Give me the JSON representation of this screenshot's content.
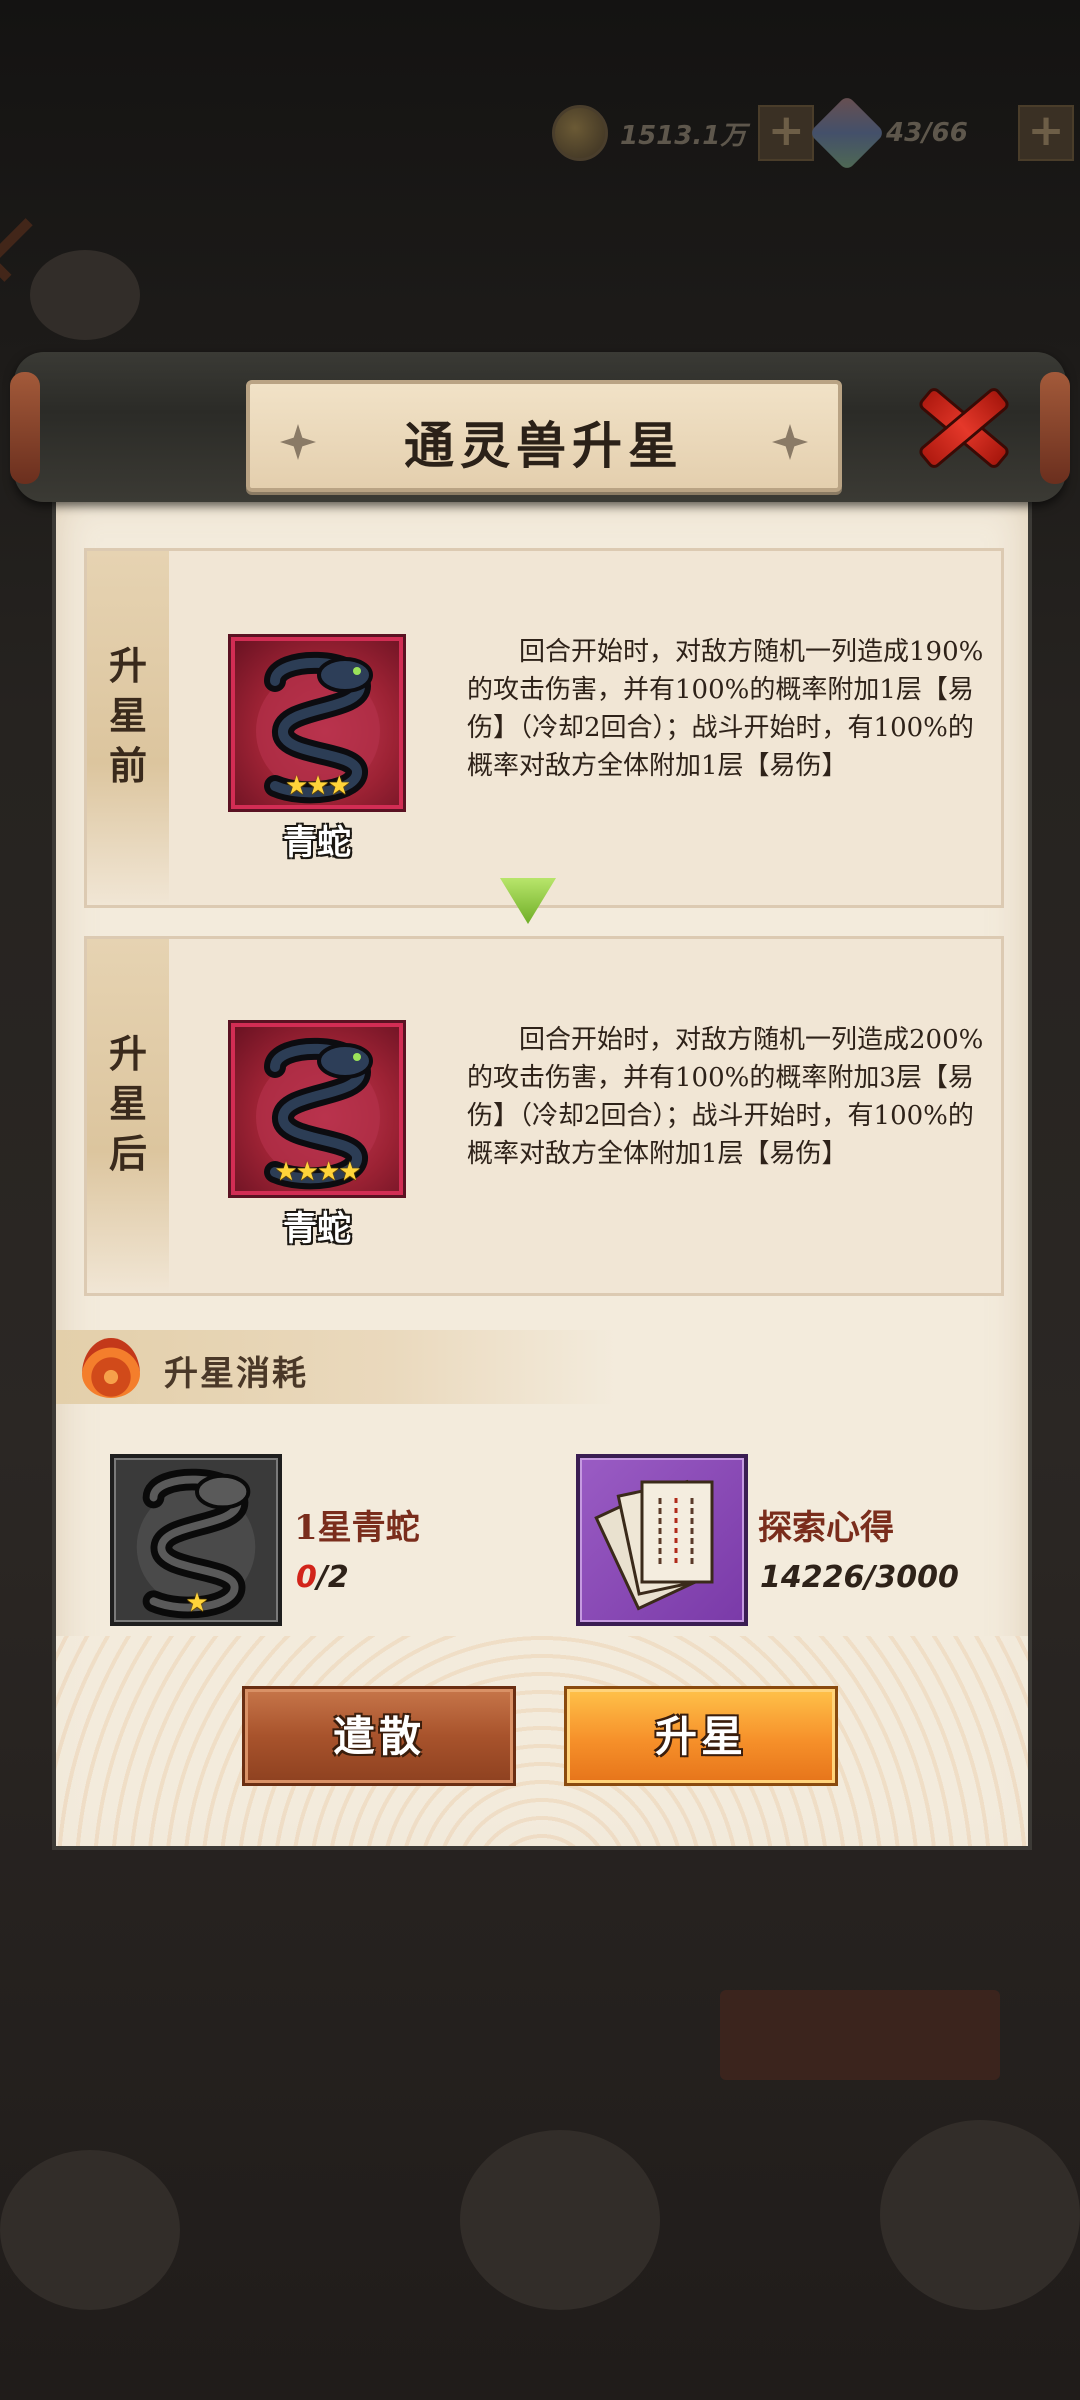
{
  "background": {
    "gold_amount": "1513.1万",
    "gem_amount": "43/66"
  },
  "dialog": {
    "title": "通灵兽升星",
    "before": {
      "label_chars": [
        "升",
        "星",
        "前"
      ],
      "pet_name": "青蛇",
      "stars": "★★★",
      "description": "回合开始时，对敌方随机一列造成190%的攻击伤害，并有100%的概率附加1层【易伤】（冷却2回合）；战斗开始时，有100%的概率对敌方全体附加1层【易伤】"
    },
    "after": {
      "label_chars": [
        "升",
        "星",
        "后"
      ],
      "pet_name": "青蛇",
      "stars": "★★★★",
      "description": "回合开始时，对敌方随机一列造成200%的攻击伤害，并有100%的概率附加3层【易伤】（冷却2回合）；战斗开始时，有100%的概率对敌方全体附加1层【易伤】"
    },
    "cost": {
      "title": "升星消耗",
      "items": [
        {
          "name": "1星青蛇",
          "have": "0",
          "need": "/2",
          "stars": "★"
        },
        {
          "name": "探索心得",
          "count": "14226/3000"
        }
      ]
    },
    "buttons": {
      "dismiss": "遣散",
      "upgrade": "升星"
    }
  },
  "colors": {
    "accent_red": "#d2241a",
    "button_orange": "#f6902a",
    "button_brown": "#a8532c",
    "card_frame_pink": "#d22d54",
    "item_frame_purple": "#8a4ab5"
  }
}
